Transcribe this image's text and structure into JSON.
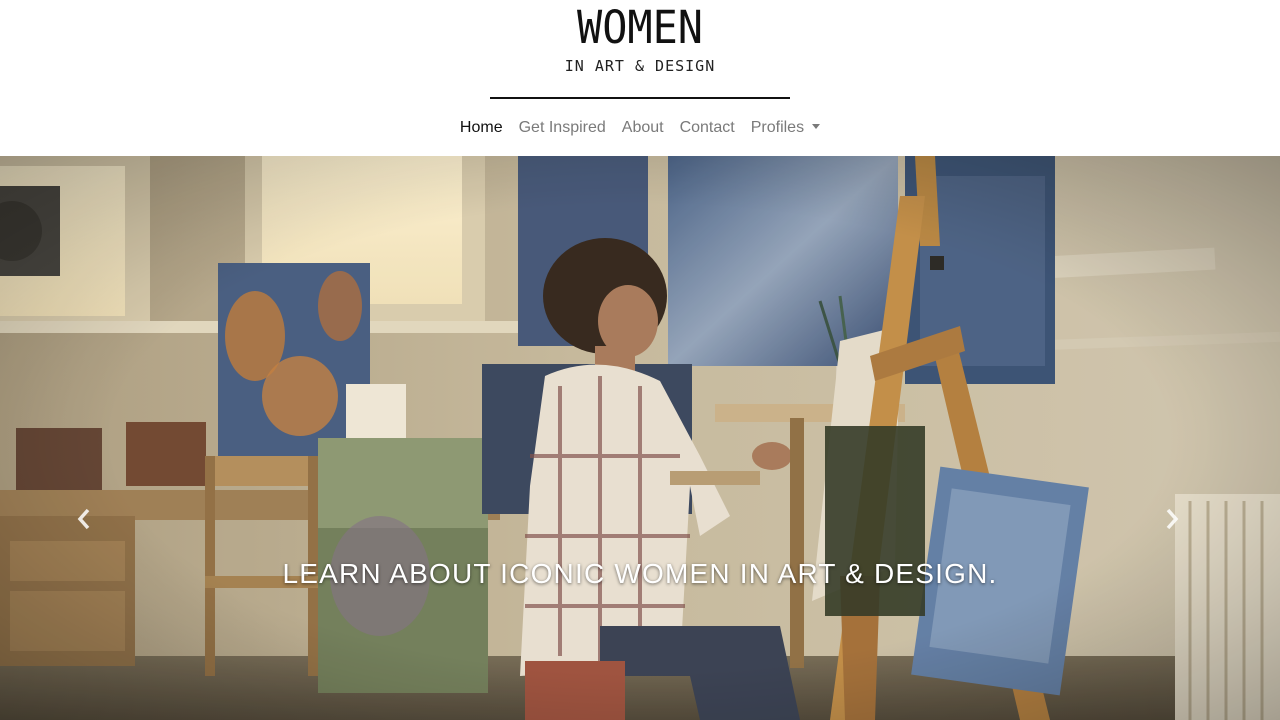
{
  "logo": {
    "title": "WOMEN",
    "subtitle": "IN ART & DESIGN"
  },
  "nav": {
    "items": [
      {
        "label": "Home",
        "active": true
      },
      {
        "label": "Get Inspired",
        "active": false
      },
      {
        "label": "About",
        "active": false
      },
      {
        "label": "Contact",
        "active": false
      },
      {
        "label": "Profiles",
        "active": false,
        "dropdown": true
      }
    ]
  },
  "carousel": {
    "caption": "LEARN ABOUT ICONIC WOMEN IN ART & DESIGN.",
    "prev_icon": "chevron-left-icon",
    "next_icon": "chevron-right-icon"
  },
  "colors": {
    "active_nav": "#111111",
    "nav": "#7a7a7a",
    "caption": "#ffffff"
  }
}
